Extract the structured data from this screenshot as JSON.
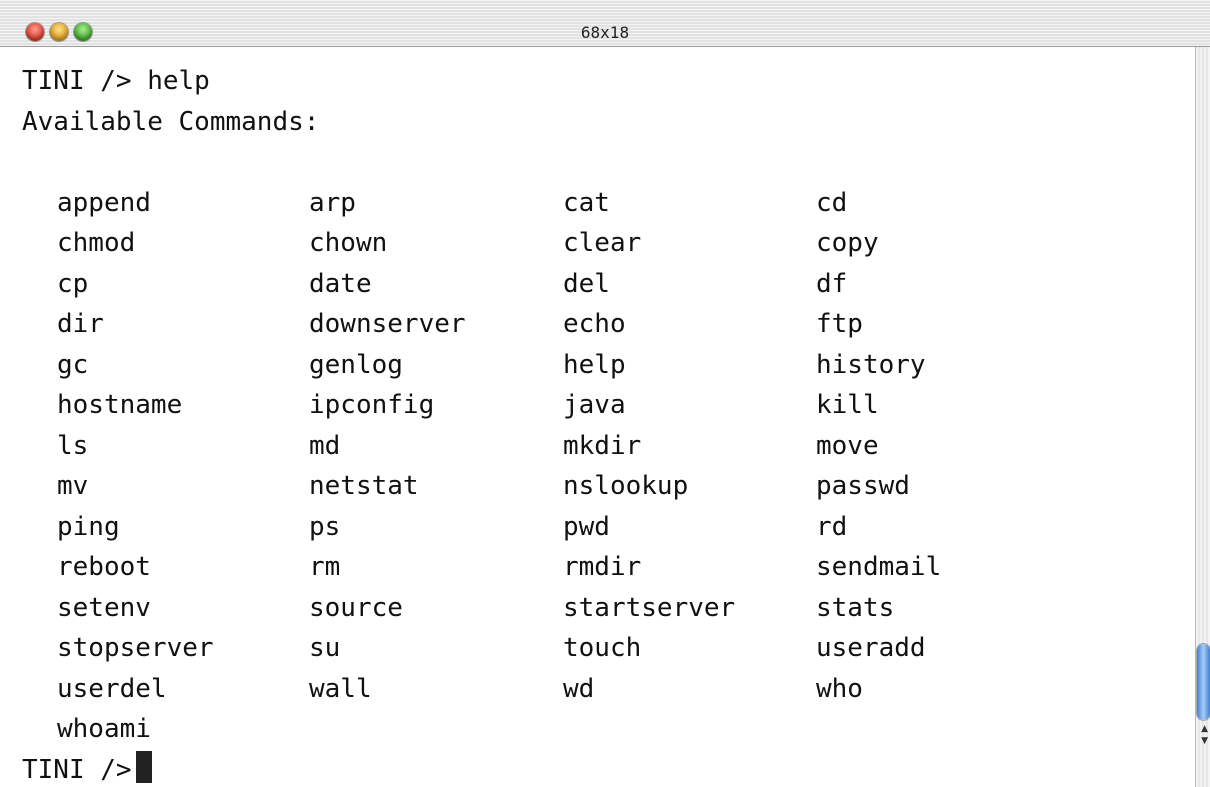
{
  "window": {
    "title": "68x18"
  },
  "terminal": {
    "prompt_line": "TINI /> help",
    "header": "Available Commands:",
    "commands": [
      [
        "append",
        "arp",
        "cat",
        "cd"
      ],
      [
        "chmod",
        "chown",
        "clear",
        "copy"
      ],
      [
        "cp",
        "date",
        "del",
        "df"
      ],
      [
        "dir",
        "downserver",
        "echo",
        "ftp"
      ],
      [
        "gc",
        "genlog",
        "help",
        "history"
      ],
      [
        "hostname",
        "ipconfig",
        "java",
        "kill"
      ],
      [
        "ls",
        "md",
        "mkdir",
        "move"
      ],
      [
        "mv",
        "netstat",
        "nslookup",
        "passwd"
      ],
      [
        "ping",
        "ps",
        "pwd",
        "rd"
      ],
      [
        "reboot",
        "rm",
        "rmdir",
        "sendmail"
      ],
      [
        "setenv",
        "source",
        "startserver",
        "stats"
      ],
      [
        "stopserver",
        "su",
        "touch",
        "useradd"
      ],
      [
        "userdel",
        "wall",
        "wd",
        "who"
      ],
      [
        "whoami"
      ]
    ],
    "final_prompt": "TINI />"
  },
  "icons": {
    "close": "close-button-icon",
    "minimize": "minimize-button-icon",
    "zoom": "zoom-button-icon",
    "scroll_up": "scroll-up-arrow-icon",
    "scroll_down": "scroll-down-arrow-icon"
  }
}
